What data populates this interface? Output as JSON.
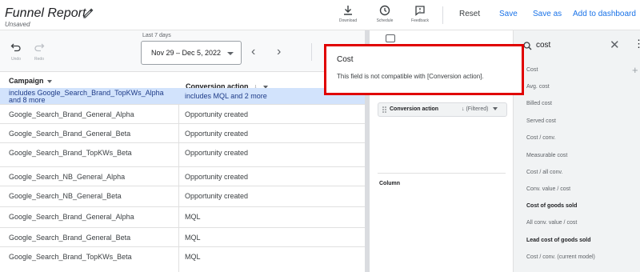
{
  "header": {
    "title": "Funnel Report",
    "subtitle": "Unsaved",
    "download_label": "Download",
    "schedule_label": "Schedule",
    "feedback_label": "Feedback",
    "reset_label": "Reset",
    "save_label": "Save",
    "save_as_label": "Save as",
    "add_to_dashboard_label": "Add to dashboard"
  },
  "toolbar": {
    "undo_label": "Undo",
    "redo_label": "Redo",
    "range_caption": "Last 7 days",
    "date_range": "Nov 29 – Dec 5, 2022"
  },
  "table": {
    "columns": [
      "Campaign",
      "Conversion action"
    ],
    "filter_row": {
      "campaign": "includes Google_Search_Brand_TopKWs_Alpha and 8 more",
      "conversion": "includes MQL and 2 more"
    },
    "rows": [
      [
        "Google_Search_Brand_General_Alpha",
        "Opportunity created"
      ],
      [
        "Google_Search_Brand_General_Beta",
        "Opportunity created"
      ],
      [
        "Google_Search_Brand_TopKWs_Beta",
        "Opportunity created"
      ],
      [
        "Google_Search_NB_General_Alpha",
        "Opportunity created"
      ],
      [
        "Google_Search_NB_General_Beta",
        "Opportunity created"
      ],
      [
        "Google_Search_Brand_General_Alpha",
        "MQL"
      ],
      [
        "Google_Search_Brand_General_Beta",
        "MQL"
      ],
      [
        "Google_Search_Brand_TopKWs_Beta",
        "MQL"
      ]
    ]
  },
  "panel": {
    "chip_label": "Conversion action",
    "chip_filter": "(Filtered)",
    "column_label": "Column"
  },
  "field_picker": {
    "query": "cost",
    "fields": [
      {
        "label": "Cost",
        "bold": false
      },
      {
        "label": "Avg. cost",
        "bold": false
      },
      {
        "label": "Billed cost",
        "bold": false
      },
      {
        "label": "Served cost",
        "bold": false
      },
      {
        "label": "Cost / conv.",
        "bold": false
      },
      {
        "label": "Measurable cost",
        "bold": false
      },
      {
        "label": "Cost / all conv.",
        "bold": false
      },
      {
        "label": "Conv. value / cost",
        "bold": false
      },
      {
        "label": "Cost of goods sold",
        "bold": true
      },
      {
        "label": "All conv. value / cost",
        "bold": false
      },
      {
        "label": "Lead cost of goods sold",
        "bold": true
      },
      {
        "label": "Cost / conv. (current model)",
        "bold": false
      }
    ]
  },
  "tooltip": {
    "title": "Cost",
    "message": "This field is not compatible with [Conversion action]."
  }
}
